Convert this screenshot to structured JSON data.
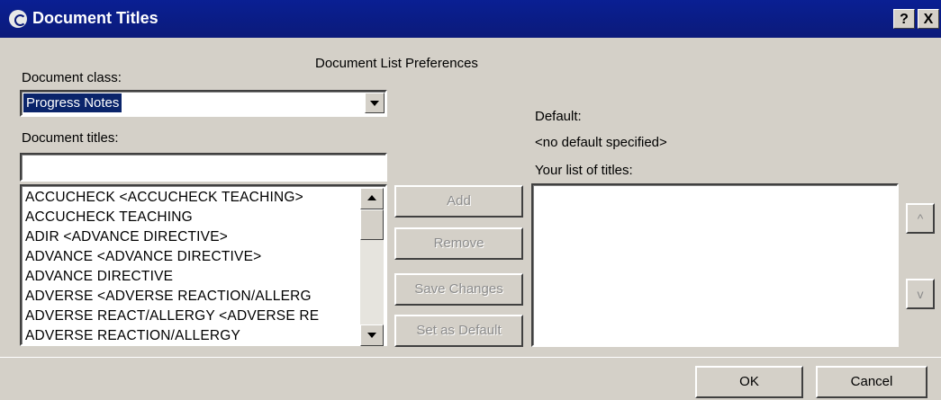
{
  "window": {
    "title": "Document Titles",
    "help_label": "?",
    "close_label": "X"
  },
  "header": {
    "title": "Document List Preferences"
  },
  "document_class": {
    "label": "Document class:",
    "value": "Progress Notes"
  },
  "document_titles": {
    "label": "Document titles:",
    "input_value": "",
    "items": [
      "ACCUCHECK  <ACCUCHECK TEACHING>",
      "ACCUCHECK TEACHING",
      "ADIR <ADVANCE DIRECTIVE>",
      "ADVANCE  <ADVANCE DIRECTIVE>",
      "ADVANCE DIRECTIVE",
      "ADVERSE  <ADVERSE REACTION/ALLERG",
      "ADVERSE REACT/ALLERGY <ADVERSE RE",
      "ADVERSE REACTION/ALLERGY"
    ]
  },
  "actions": {
    "add": "Add",
    "remove": "Remove",
    "save_changes": "Save Changes",
    "set_default": "Set as Default"
  },
  "default": {
    "label": "Default:",
    "value": "<no default specified>"
  },
  "your_list": {
    "label": "Your list of titles:",
    "items": []
  },
  "move": {
    "up": "^",
    "down": "v"
  },
  "footer": {
    "ok": "OK",
    "cancel": "Cancel"
  },
  "colors": {
    "titlebar": "#0b1a7a",
    "selection": "#0a246a",
    "face": "#d4d0c8"
  }
}
